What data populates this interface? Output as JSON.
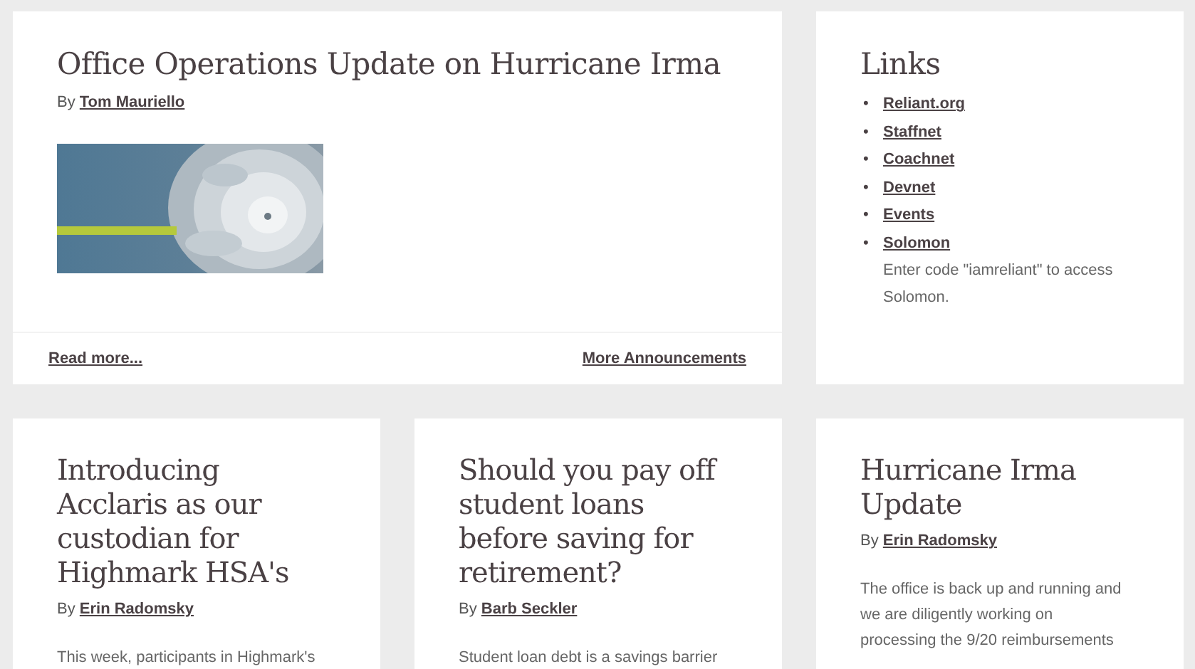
{
  "featured": {
    "title": "Office Operations Update on Hurricane Irma",
    "byline_prefix": "By",
    "author": "Tom Mauriello",
    "image": {
      "kind": "picture"
    },
    "footer_links": [
      "Read more...",
      "More Announcements"
    ]
  },
  "links_panel": {
    "title": "Links",
    "bullet": "•",
    "items": [
      "Reliant.org",
      "Staffnet",
      "Coachnet",
      "Devnet",
      "Events",
      "Solomon"
    ],
    "note": "Enter code \"iamreliant\" to access Solomon."
  },
  "articles": [
    {
      "title": "Introducing Acclaris as our custodian for Highmark HSA's",
      "byline_prefix": "By",
      "author": "Erin Radomsky",
      "excerpt": "This week, participants in Highmark's"
    },
    {
      "title": "Should you pay off student loans before saving for retirement?",
      "byline_prefix": "By",
      "author": "Barb Seckler",
      "excerpt": "Student loan debt is a savings barrier"
    },
    {
      "title": "Hurricane Irma Update",
      "byline_prefix": "By",
      "author": "Erin Radomsky",
      "excerpt": "The office is back up and running and we are diligently working on processing the 9/20 reimbursements"
    }
  ]
}
